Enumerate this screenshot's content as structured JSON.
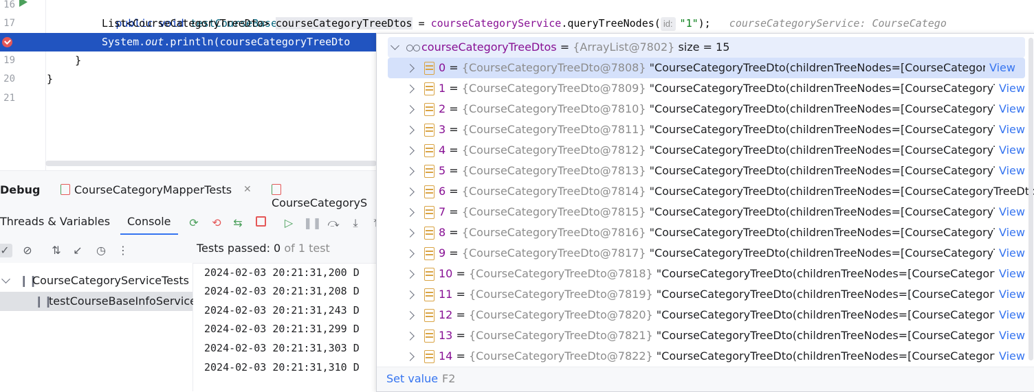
{
  "editor": {
    "lines": [
      {
        "num": "16",
        "parts": [
          {
            "t": "    ",
            "c": ""
          },
          {
            "t": "public",
            "c": "kw"
          },
          {
            "t": " ",
            "c": ""
          },
          {
            "t": "void",
            "c": "kw"
          },
          {
            "t": " ",
            "c": ""
          },
          {
            "t": "testCourseBaseInfoService",
            "c": "fn"
          },
          {
            "t": "(){",
            "c": ""
          }
        ]
      },
      {
        "num": "17"
      },
      {
        "num": ""
      },
      {
        "num": "19",
        "parts": [
          {
            "t": "    }",
            "c": ""
          }
        ]
      },
      {
        "num": "20",
        "parts": [
          {
            "t": "}",
            "c": ""
          }
        ]
      },
      {
        "num": "21",
        "parts": [
          {
            "t": "",
            "c": ""
          }
        ]
      }
    ],
    "line17": {
      "type": "List<CourseCategoryTreeDto> ",
      "var": "courseCategoryTreeDtos",
      "assign": " = ",
      "service": "courseCategoryService",
      "call": ".queryTreeNodes(",
      "hint": "id:",
      "arg": "\"1\"",
      "end": ");",
      "inline": "courseCategoryService: CourseCatego"
    },
    "line18": {
      "prefix": "System.",
      "out": "out",
      "rest": ".println(courseCategoryTreeDto"
    }
  },
  "debug": {
    "title": "Debug",
    "tabs": [
      {
        "label": "CourseCategoryMapperTests"
      },
      {
        "label": "CourseCategoryS"
      }
    ],
    "subtabs": {
      "threads": "Threads & Variables",
      "console": "Console"
    },
    "tests_status": {
      "prefix": "Tests passed: ",
      "passed": "0",
      "suffix": " of 1 test"
    },
    "tests": [
      {
        "label": "CourseCategoryServiceTests"
      },
      {
        "label": "testCourseBaseInfoService"
      }
    ],
    "console_lines": [
      "2024-02-03 20:21:31,200 D",
      "2024-02-03 20:21:31,208 D",
      "2024-02-03 20:21:31,243 D",
      "2024-02-03 20:21:31,299 D",
      "2024-02-03 20:21:31,303 D",
      "2024-02-03 20:21:31,310 D"
    ]
  },
  "popup": {
    "root": {
      "name": "courseCategoryTreeDtos",
      "type": "{ArrayList@7802}",
      "size": "size = 15"
    },
    "value_text": "\"CourseCategoryTreeDto(childrenTreeNodes=[CourseCategoryTre…",
    "row6_text": "\"CourseCategoryTreeDto(childrenTreeNodes=[CourseCategoryTreeDto(chi",
    "view": "View",
    "items": [
      {
        "index": "0",
        "ref": "{CourseCategoryTreeDto@7808}"
      },
      {
        "index": "1",
        "ref": "{CourseCategoryTreeDto@7809}"
      },
      {
        "index": "2",
        "ref": "{CourseCategoryTreeDto@7810}"
      },
      {
        "index": "3",
        "ref": "{CourseCategoryTreeDto@7811}"
      },
      {
        "index": "4",
        "ref": "{CourseCategoryTreeDto@7812}"
      },
      {
        "index": "5",
        "ref": "{CourseCategoryTreeDto@7813}"
      },
      {
        "index": "6",
        "ref": "{CourseCategoryTreeDto@7814}"
      },
      {
        "index": "7",
        "ref": "{CourseCategoryTreeDto@7815}"
      },
      {
        "index": "8",
        "ref": "{CourseCategoryTreeDto@7816}"
      },
      {
        "index": "9",
        "ref": "{CourseCategoryTreeDto@7817}"
      },
      {
        "index": "10",
        "ref": "{CourseCategoryTreeDto@7818}"
      },
      {
        "index": "11",
        "ref": "{CourseCategoryTreeDto@7819}"
      },
      {
        "index": "12",
        "ref": "{CourseCategoryTreeDto@7820}"
      },
      {
        "index": "13",
        "ref": "{CourseCategoryTreeDto@7821}"
      },
      {
        "index": "14",
        "ref": "{CourseCategoryTreeDto@7822}"
      }
    ],
    "footer": {
      "action": "Set value",
      "shortcut": "F2"
    }
  }
}
